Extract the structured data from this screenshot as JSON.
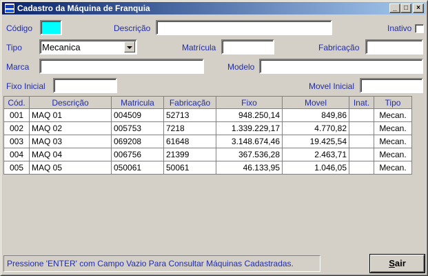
{
  "window": {
    "title": "Cadastro da Máquina de Franquia"
  },
  "titlebar_buttons": {
    "minimize": "_",
    "maximize": "□",
    "close": "×"
  },
  "form": {
    "codigo": {
      "label": "Código",
      "value": ""
    },
    "descricao": {
      "label": "Descrição",
      "value": ""
    },
    "inativo": {
      "label": "Inativo",
      "checked": false
    },
    "tipo": {
      "label": "Tipo",
      "value": "Mecanica"
    },
    "matricula": {
      "label": "Matrícula",
      "value": ""
    },
    "fabricacao": {
      "label": "Fabricação",
      "value": ""
    },
    "marca": {
      "label": "Marca",
      "value": ""
    },
    "modelo": {
      "label": "Modelo",
      "value": ""
    },
    "fixo_inicial": {
      "label": "Fixo Inicial",
      "value": ""
    },
    "movel_inicial": {
      "label": "Movel Inicial",
      "value": ""
    }
  },
  "table": {
    "headers": [
      "Cód.",
      "Descrição",
      "Matricula",
      "Fabricação",
      "Fixo",
      "Movel",
      "Inat.",
      "Tipo"
    ],
    "rows": [
      [
        "001",
        "MAQ 01",
        "004509",
        "52713",
        "948.250,14",
        "849,86",
        "",
        "Mecan."
      ],
      [
        "002",
        "MAQ 02",
        "005753",
        "7218",
        "1.339.229,17",
        "4.770,82",
        "",
        "Mecan."
      ],
      [
        "003",
        "MAQ 03",
        "069208",
        "61648",
        "3.148.674,46",
        "19.425,54",
        "",
        "Mecan."
      ],
      [
        "004",
        "MAQ 04",
        "006756",
        "21399",
        "367.536,28",
        "2.463,71",
        "",
        "Mecan."
      ],
      [
        "005",
        "MAQ 05",
        "050061",
        "50061",
        "46.133,95",
        "1.046,05",
        "",
        "Mecan."
      ]
    ]
  },
  "status": {
    "message": "Pressione 'ENTER' com Campo Vazio Para Consultar Máquinas Cadastradas."
  },
  "buttons": {
    "exit_first": "S",
    "exit_rest": "air"
  },
  "colors": {
    "label_blue": "#1f2bb0",
    "highlight": "#00ffff",
    "title_start": "#0a246a",
    "title_end": "#a6caf0"
  }
}
